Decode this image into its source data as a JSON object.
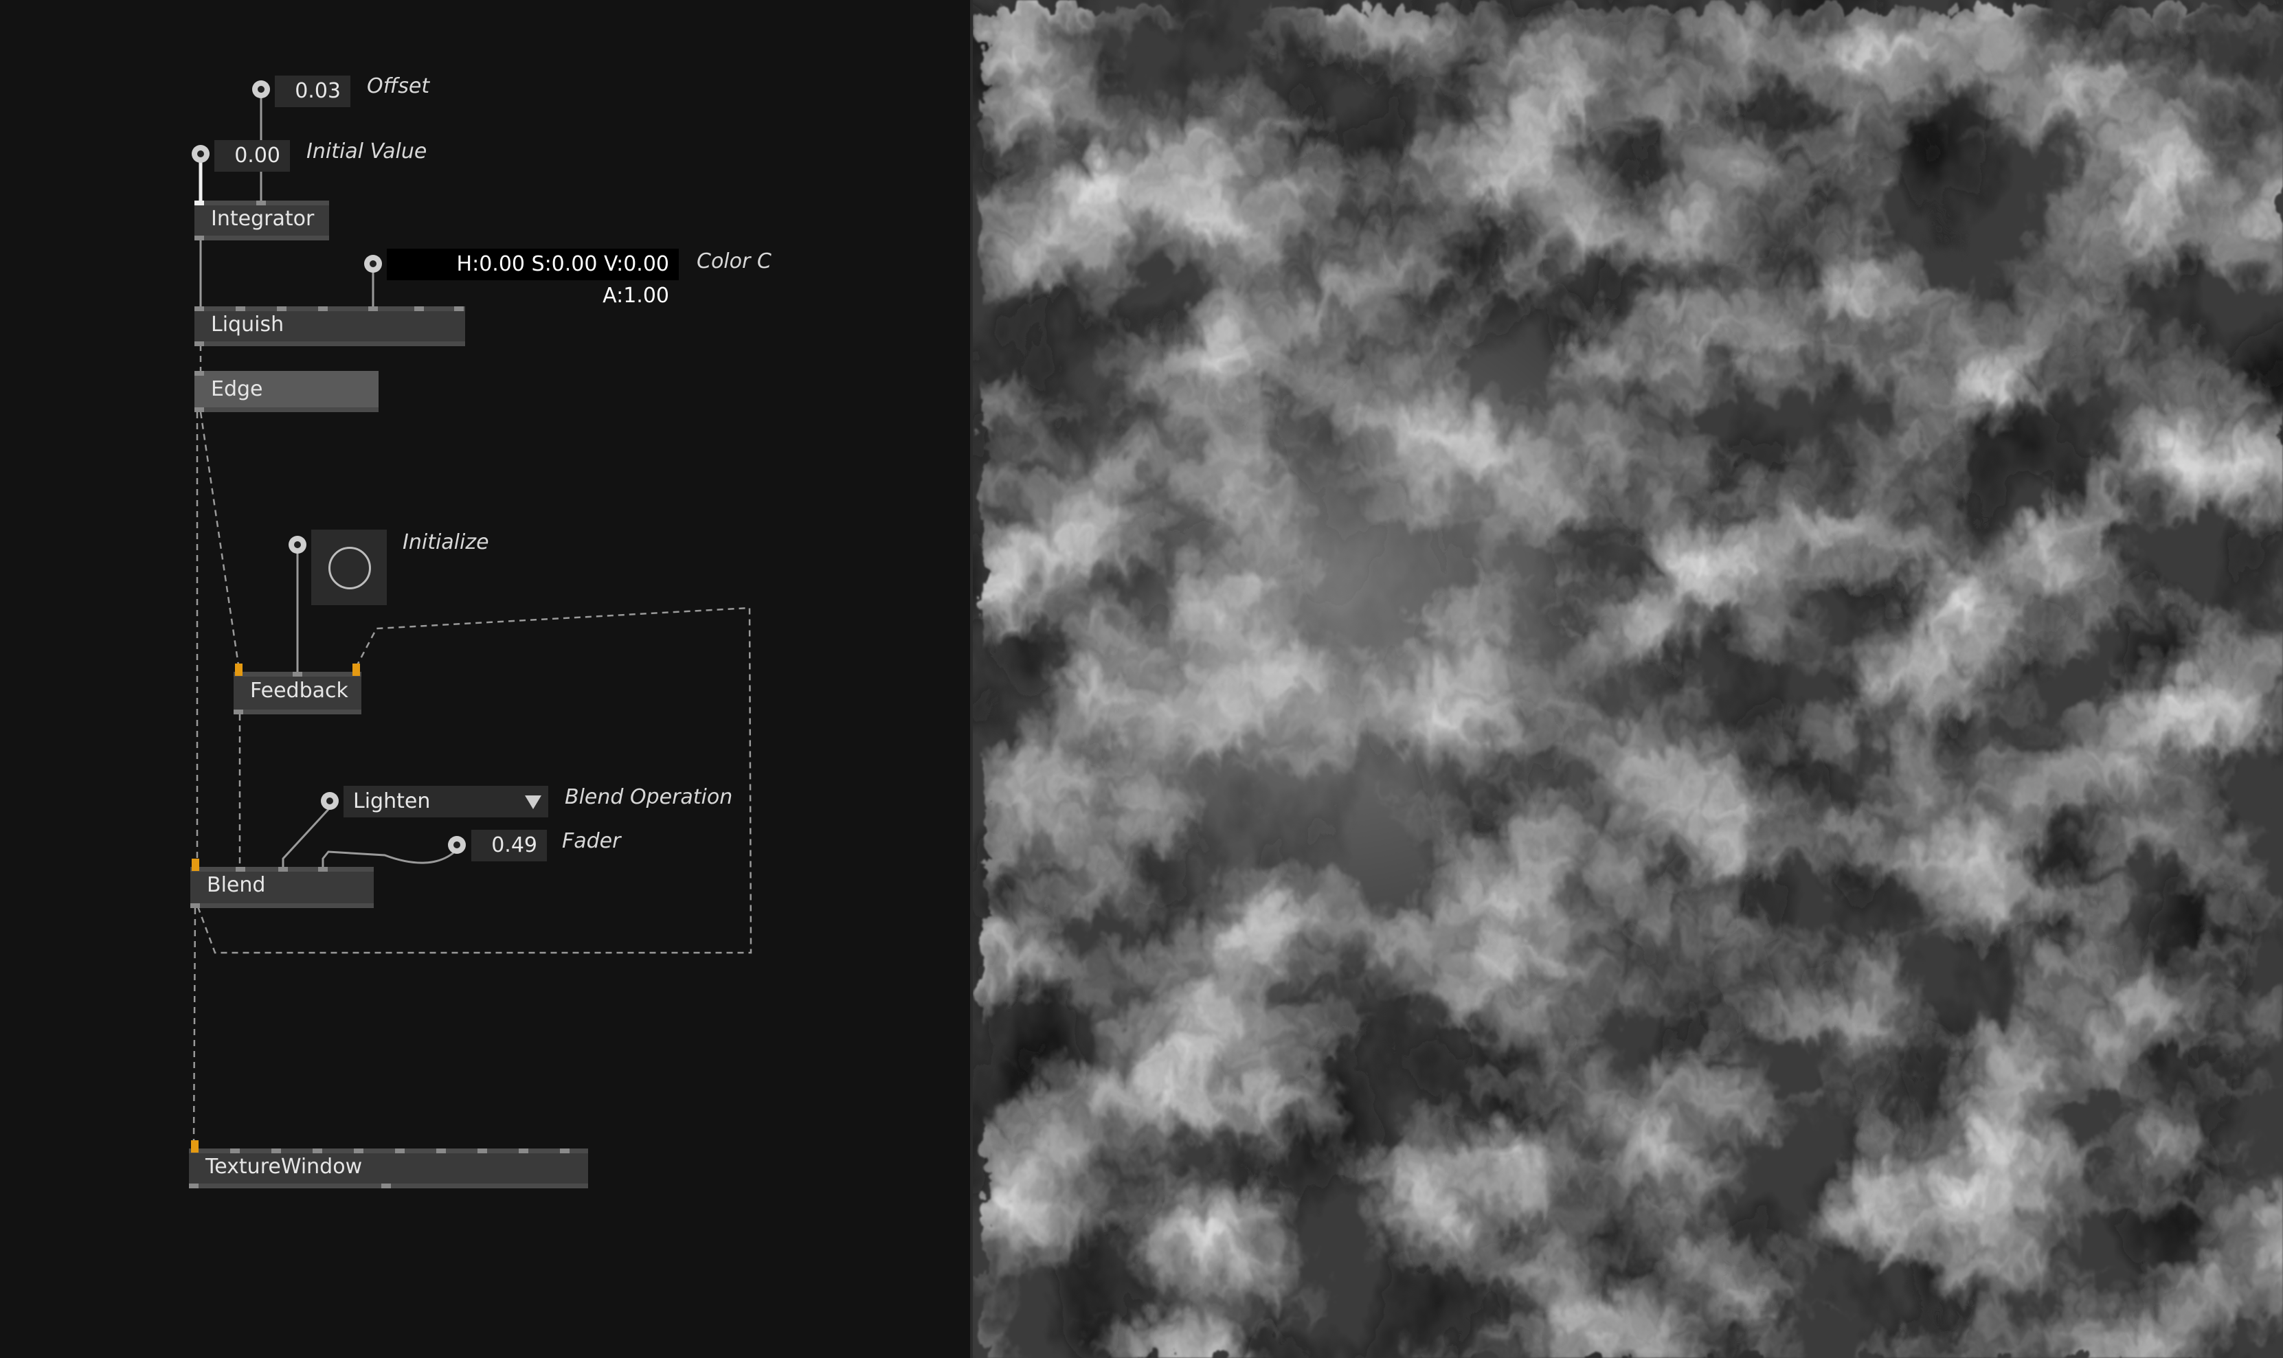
{
  "patch": {
    "offset": {
      "value": "0.03",
      "label": "Offset"
    },
    "initial_value": {
      "value": "0.00",
      "label": "Initial Value"
    },
    "integrator": {
      "label": "Integrator"
    },
    "color_c": {
      "value": "H:0.00 S:0.00 V:0.00 A:1.00",
      "label": "Color C"
    },
    "liquish": {
      "label": "Liquish"
    },
    "edge": {
      "label": "Edge"
    },
    "initialize": {
      "label": "Initialize",
      "icon": "circle-bang-icon"
    },
    "feedback": {
      "label": "Feedback"
    },
    "blend_operation": {
      "value": "Lighten",
      "label": "Blend Operation",
      "icon": "dropdown-triangle-icon"
    },
    "fader": {
      "value": "0.49",
      "label": "Fader"
    },
    "blend": {
      "label": "Blend"
    },
    "texture_window": {
      "label": "TextureWindow"
    }
  },
  "colors": {
    "background": "#121212",
    "node": "#3a3a3a",
    "iobox": "#2b2b2b",
    "active_pin": "#e59a12",
    "wire": "#9a9a9a"
  },
  "render": {
    "description_icon": "smoke-texture-output"
  }
}
